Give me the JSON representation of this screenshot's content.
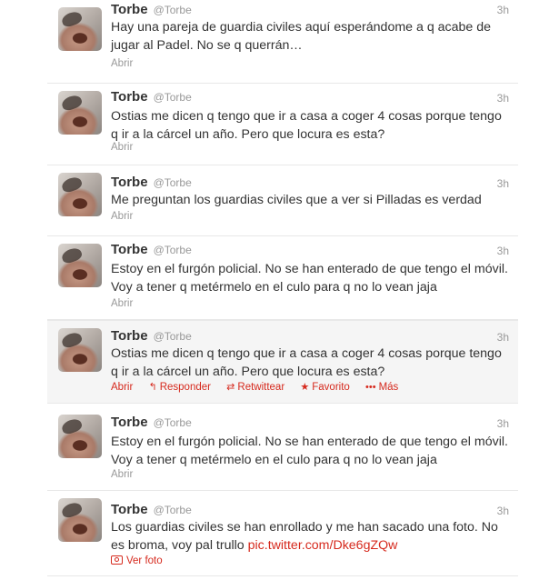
{
  "tweets": [
    {
      "name": "Torbe",
      "handle": "@Torbe",
      "time": "3h",
      "text": "Hay una pareja de guardia civiles aquí esperándome a q acabe de jugar al Padel. No se q querrán…",
      "open_label": "Abrir"
    },
    {
      "name": "Torbe",
      "handle": "@Torbe",
      "time": "3h",
      "text": "Ostias me dicen q tengo que ir a casa a coger 4 cosas porque tengo q ir a la cárcel un año. Pero que locura es esta?",
      "open_label": "Abrir"
    },
    {
      "name": "Torbe",
      "handle": "@Torbe",
      "time": "3h",
      "text": "Me preguntan los guardias civiles que a ver si Pilladas es verdad",
      "open_label": "Abrir"
    },
    {
      "name": "Torbe",
      "handle": "@Torbe",
      "time": "3h",
      "text": "Estoy en el furgón policial. No se han enterado de que tengo el móvil. Voy a tener q metérmelo en el culo para q no lo vean jaja",
      "open_label": "Abrir"
    },
    {
      "name": "Torbe",
      "handle": "@Torbe",
      "time": "3h",
      "text": "Ostias me dicen q tengo que ir a casa a coger 4 cosas porque tengo q ir a la cárcel un año. Pero que locura es esta?",
      "open_label": "Abrir",
      "reply_label": "Responder",
      "retweet_label": "Retwittear",
      "favorite_label": "Favorito",
      "more_label": "Más"
    },
    {
      "name": "Torbe",
      "handle": "@Torbe",
      "time": "3h",
      "text": "Estoy en el furgón policial. No se han enterado de que tengo el móvil. Voy a tener q metérmelo en el culo para q no lo vean jaja",
      "open_label": "Abrir"
    },
    {
      "name": "Torbe",
      "handle": "@Torbe",
      "time": "3h",
      "text": "Los guardias civiles se han enrollado y me han sacado una foto. No es broma, voy pal trullo",
      "link": "pic.twitter.com/Dke6gZQw",
      "photo_label": "Ver foto"
    }
  ],
  "colors": {
    "link": "#d62a1e",
    "muted": "#999999",
    "text": "#333333"
  },
  "icons": {
    "reply": "reply-arrow-icon",
    "retweet": "retweet-icon",
    "favorite": "star-icon",
    "more": "more-dots-icon",
    "photo": "photo-icon"
  }
}
